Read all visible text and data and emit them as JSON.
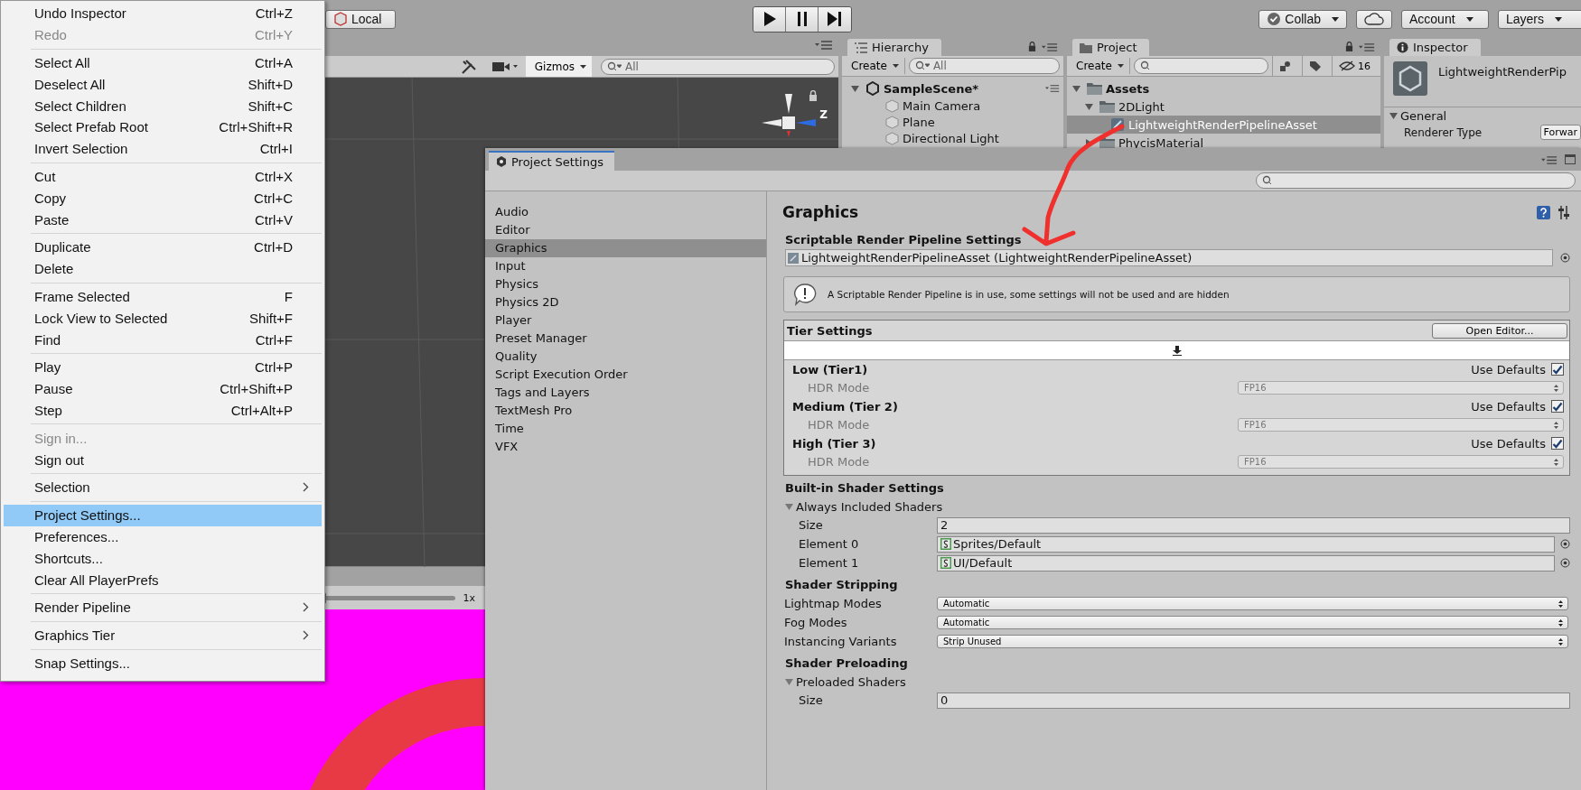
{
  "toolbar": {
    "pivot": "Local",
    "collab": "Collab",
    "account": "Account",
    "layers": "Layers"
  },
  "scene_view": {
    "gizmos": "Gizmos",
    "search_placeholder": "All",
    "axis_label": "Z"
  },
  "game_view": {
    "scale": "1x",
    "level": 0
  },
  "hierarchy": {
    "title": "Hierarchy",
    "create": "Create",
    "search_placeholder": "All",
    "scene": "SampleScene*",
    "items": [
      "Main Camera",
      "Plane",
      "Directional Light"
    ]
  },
  "project": {
    "title": "Project",
    "create": "Create",
    "hidden_count": "16",
    "tree": [
      {
        "label": "Assets",
        "expanded": true,
        "selected": false,
        "children": [
          {
            "label": "2DLight",
            "expanded": true,
            "selected": false,
            "children": [
              {
                "label": "LightweightRenderPipelineAsset",
                "selected": true
              }
            ]
          },
          {
            "label": "PhycisMaterial",
            "expanded": false,
            "selected": false
          }
        ]
      }
    ]
  },
  "inspector": {
    "title": "Inspector",
    "asset_name": "LightweightRenderPip",
    "section": "General",
    "field_label": "Renderer Type",
    "field_value": "Forwar"
  },
  "edit_menu": {
    "groups": [
      [
        {
          "label": "Undo Inspector",
          "shortcut": "Ctrl+Z",
          "disabled": false,
          "selected": false,
          "submenu": false
        },
        {
          "label": "Redo",
          "shortcut": "Ctrl+Y",
          "disabled": true,
          "selected": false,
          "submenu": false
        }
      ],
      [
        {
          "label": "Select All",
          "shortcut": "Ctrl+A",
          "disabled": false,
          "selected": false,
          "submenu": false
        },
        {
          "label": "Deselect All",
          "shortcut": "Shift+D",
          "disabled": false,
          "selected": false,
          "submenu": false
        },
        {
          "label": "Select Children",
          "shortcut": "Shift+C",
          "disabled": false,
          "selected": false,
          "submenu": false
        },
        {
          "label": "Select Prefab Root",
          "shortcut": "Ctrl+Shift+R",
          "disabled": false,
          "selected": false,
          "submenu": false
        },
        {
          "label": "Invert Selection",
          "shortcut": "Ctrl+I",
          "disabled": false,
          "selected": false,
          "submenu": false
        }
      ],
      [
        {
          "label": "Cut",
          "shortcut": "Ctrl+X",
          "disabled": false,
          "selected": false,
          "submenu": false
        },
        {
          "label": "Copy",
          "shortcut": "Ctrl+C",
          "disabled": false,
          "selected": false,
          "submenu": false
        },
        {
          "label": "Paste",
          "shortcut": "Ctrl+V",
          "disabled": false,
          "selected": false,
          "submenu": false
        }
      ],
      [
        {
          "label": "Duplicate",
          "shortcut": "Ctrl+D",
          "disabled": false,
          "selected": false,
          "submenu": false
        },
        {
          "label": "Delete",
          "disabled": false,
          "selected": false,
          "submenu": false
        }
      ],
      [
        {
          "label": "Frame Selected",
          "shortcut": "F",
          "disabled": false,
          "selected": false,
          "submenu": false
        },
        {
          "label": "Lock View to Selected",
          "shortcut": "Shift+F",
          "disabled": false,
          "selected": false,
          "submenu": false
        },
        {
          "label": "Find",
          "shortcut": "Ctrl+F",
          "disabled": false,
          "selected": false,
          "submenu": false
        }
      ],
      [
        {
          "label": "Play",
          "shortcut": "Ctrl+P",
          "disabled": false,
          "selected": false,
          "submenu": false
        },
        {
          "label": "Pause",
          "shortcut": "Ctrl+Shift+P",
          "disabled": false,
          "selected": false,
          "submenu": false
        },
        {
          "label": "Step",
          "shortcut": "Ctrl+Alt+P",
          "disabled": false,
          "selected": false,
          "submenu": false
        }
      ],
      [
        {
          "label": "Sign in...",
          "disabled": true,
          "selected": false,
          "submenu": false
        },
        {
          "label": "Sign out",
          "disabled": false,
          "selected": false,
          "submenu": false
        }
      ],
      [
        {
          "label": "Selection",
          "disabled": false,
          "selected": false,
          "submenu": true
        }
      ],
      [
        {
          "label": "Project Settings...",
          "disabled": false,
          "selected": true,
          "submenu": false
        },
        {
          "label": "Preferences...",
          "disabled": false,
          "selected": false,
          "submenu": false
        },
        {
          "label": "Shortcuts...",
          "disabled": false,
          "selected": false,
          "submenu": false
        },
        {
          "label": "Clear All PlayerPrefs",
          "disabled": false,
          "selected": false,
          "submenu": false
        }
      ],
      [
        {
          "label": "Render Pipeline",
          "disabled": false,
          "selected": false,
          "submenu": true
        }
      ],
      [
        {
          "label": "Graphics Tier",
          "disabled": false,
          "selected": false,
          "submenu": true
        }
      ],
      [
        {
          "label": "Snap Settings...",
          "disabled": false,
          "selected": false,
          "submenu": false
        }
      ]
    ]
  },
  "project_settings": {
    "title": "Project Settings",
    "categories": [
      {
        "label": "Audio",
        "selected": false
      },
      {
        "label": "Editor",
        "selected": false
      },
      {
        "label": "Graphics",
        "selected": true
      },
      {
        "label": "Input",
        "selected": false
      },
      {
        "label": "Physics",
        "selected": false
      },
      {
        "label": "Physics 2D",
        "selected": false
      },
      {
        "label": "Player",
        "selected": false
      },
      {
        "label": "Preset Manager",
        "selected": false
      },
      {
        "label": "Quality",
        "selected": false
      },
      {
        "label": "Script Execution Order",
        "selected": false
      },
      {
        "label": "Tags and Layers",
        "selected": false
      },
      {
        "label": "TextMesh Pro",
        "selected": false
      },
      {
        "label": "Time",
        "selected": false
      },
      {
        "label": "VFX",
        "selected": false
      }
    ],
    "graphics": {
      "title": "Graphics",
      "srp_heading": "Scriptable Render Pipeline Settings",
      "srp_value": "LightweightRenderPipelineAsset (LightweightRenderPipelineAsset)",
      "info": "A Scriptable Render Pipeline is in use, some settings will not be used and are hidden",
      "tier_settings": {
        "title": "Tier Settings",
        "button": "Open Editor...",
        "tiers": [
          {
            "name": "Low (Tier1)",
            "use_defaults_label": "Use Defaults",
            "use_defaults": true,
            "hdr_label": "HDR Mode",
            "hdr_value": "FP16"
          },
          {
            "name": "Medium (Tier 2)",
            "use_defaults_label": "Use Defaults",
            "use_defaults": true,
            "hdr_label": "HDR Mode",
            "hdr_value": "FP16"
          },
          {
            "name": "High (Tier 3)",
            "use_defaults_label": "Use Defaults",
            "use_defaults": true,
            "hdr_label": "HDR Mode",
            "hdr_value": "FP16"
          }
        ]
      },
      "builtin": {
        "title": "Built-in Shader Settings",
        "foldout": "Always Included Shaders",
        "expanded": true,
        "size_label": "Size",
        "size_value": "2",
        "elements": [
          {
            "label": "Element 0",
            "value": "Sprites/Default"
          },
          {
            "label": "Element 1",
            "value": "UI/Default"
          }
        ]
      },
      "stripping": {
        "title": "Shader Stripping",
        "rows": [
          {
            "label": "Lightmap Modes",
            "value": "Automatic"
          },
          {
            "label": "Fog Modes",
            "value": "Automatic"
          },
          {
            "label": "Instancing Variants",
            "value": "Strip Unused"
          }
        ]
      },
      "preloading": {
        "title": "Shader Preloading",
        "foldout": "Preloaded Shaders",
        "expanded": true,
        "size_label": "Size",
        "size_value": "0"
      }
    }
  }
}
